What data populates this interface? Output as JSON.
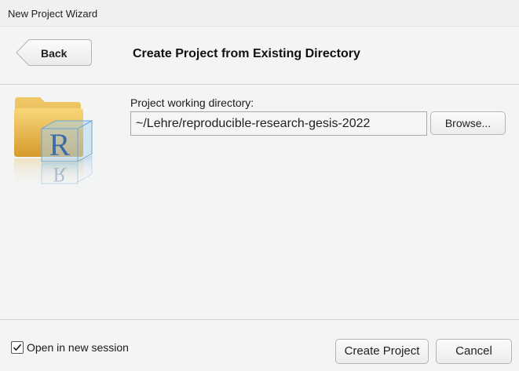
{
  "window": {
    "title": "New Project Wizard"
  },
  "header": {
    "back_label": "Back",
    "title": "Create Project from Existing Directory"
  },
  "form": {
    "directory_label": "Project working directory:",
    "directory_value": "~/Lehre/reproducible-research-gesis-2022",
    "browse_label": "Browse..."
  },
  "footer": {
    "open_new_session_label": "Open in new session",
    "open_new_session_checked": true,
    "create_label": "Create Project",
    "cancel_label": "Cancel"
  },
  "icons": {
    "folder": "folder-r-project-icon",
    "checkmark": "checkmark-icon"
  },
  "colors": {
    "background": "#f3f4f4",
    "folder_yellow": "#e9b84a",
    "r_cube_blue": "#7fb3d8",
    "r_letter": "#3d6aa8"
  }
}
